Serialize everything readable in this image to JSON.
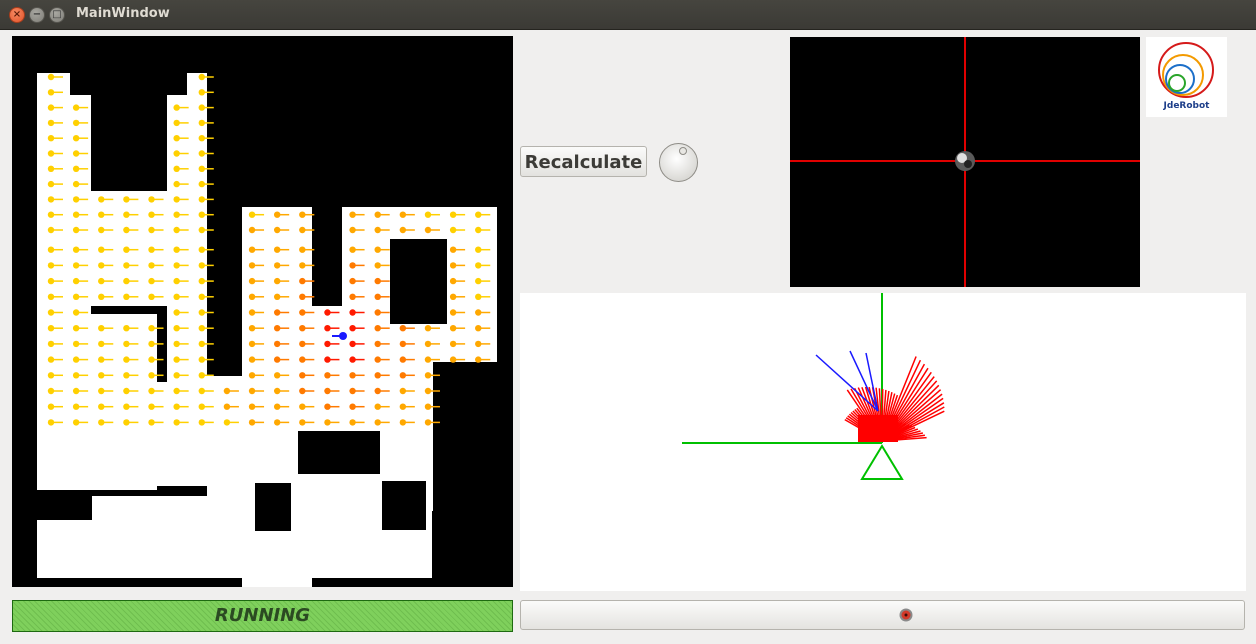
{
  "window": {
    "title": "MainWindow"
  },
  "titlebar_icons": [
    "close-icon",
    "minimize-icon",
    "maximize-icon"
  ],
  "controls": {
    "recalculate_label": "Recalculate",
    "status_text": "RUNNING",
    "status_color": "#7fd05c",
    "play_icon": "record-icon"
  },
  "logo": {
    "text": "JdeRobot"
  },
  "colors": {
    "map_background": "#000000",
    "map_free_space": "#ffffff",
    "gradient_yellow": "#ffd400",
    "gradient_orange": "#ff8a00",
    "gradient_red": "#ff1a00",
    "robot_marker": "#1a1aff",
    "crosshair": "#ff0000",
    "laser_axes": "#00c000",
    "laser_rays": "#ff0000"
  }
}
